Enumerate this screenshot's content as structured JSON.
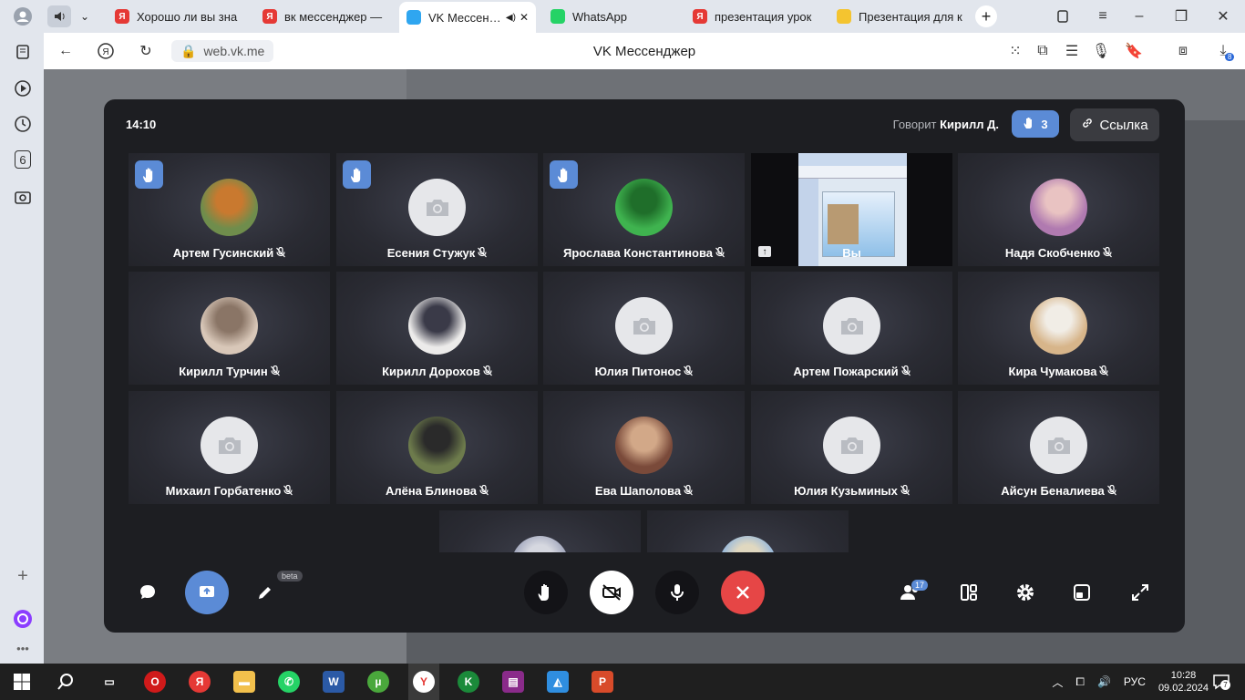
{
  "browser": {
    "tabs": [
      {
        "title": "Хорошо ли вы зна",
        "icon": "yandex-icon",
        "color": "#e53935"
      },
      {
        "title": "вк мессенджер —",
        "icon": "yandex-icon",
        "color": "#e53935"
      },
      {
        "title": "VK Мессендж",
        "icon": "vk-messenger-icon",
        "color": "#2fa6f0",
        "active": true
      },
      {
        "title": "WhatsApp",
        "icon": "whatsapp-icon",
        "color": "#25d366"
      },
      {
        "title": "презентация урок",
        "icon": "yandex-icon",
        "color": "#e53935"
      },
      {
        "title": "Презентация для к",
        "icon": "pen-icon",
        "color": "#f4c430"
      }
    ],
    "url": "web.vk.me",
    "page_title": "VK Мессенджер",
    "downloads_badge": "8",
    "sidebar_badge": "6"
  },
  "call": {
    "time": "14:10",
    "speaker_prefix": "Говорит",
    "speaker_name": "Кирилл Д.",
    "raised_hands": "3",
    "link_label": "Ссылка",
    "participants_count": "17",
    "beta_label": "beta",
    "participants": [
      {
        "name": "Артем Гусинский",
        "hand": true,
        "avatar": "photo",
        "c1": "#6f8d4c",
        "c2": "#c9792f"
      },
      {
        "name": "Есения Стужук",
        "hand": true,
        "avatar": "camera"
      },
      {
        "name": "Ярослава Константинова",
        "hand": true,
        "avatar": "photo",
        "c1": "#3fb34f",
        "c2": "#1f6e2a"
      },
      {
        "name": "Вы",
        "hand": false,
        "avatar": "screen"
      },
      {
        "name": "Надя Скобченко",
        "hand": false,
        "avatar": "photo",
        "c1": "#b07ab0",
        "c2": "#e9c3c2"
      },
      {
        "name": "Кирилл Турчин",
        "hand": false,
        "avatar": "photo",
        "c1": "#d8c7b8",
        "c2": "#8a7566"
      },
      {
        "name": "Кирилл Дорохов",
        "hand": false,
        "avatar": "photo",
        "c1": "#ecebea",
        "c2": "#3a3a48"
      },
      {
        "name": "Юлия Питонос",
        "hand": false,
        "avatar": "camera"
      },
      {
        "name": "Артем Пожарский",
        "hand": false,
        "avatar": "camera"
      },
      {
        "name": "Кира Чумакова",
        "hand": false,
        "avatar": "photo",
        "c1": "#d7b58a",
        "c2": "#f1ede6"
      },
      {
        "name": "Михаил Горбатенко",
        "hand": false,
        "avatar": "camera"
      },
      {
        "name": "Алёна Блинова",
        "hand": false,
        "avatar": "photo",
        "c1": "#6d7b4c",
        "c2": "#2a2a2a"
      },
      {
        "name": "Ева Шаполова",
        "hand": false,
        "avatar": "photo",
        "c1": "#7a4a3a",
        "c2": "#d2a888"
      },
      {
        "name": "Юлия Кузьминых",
        "hand": false,
        "avatar": "camera"
      },
      {
        "name": "Айсун Беналиева",
        "hand": false,
        "avatar": "camera"
      },
      {
        "name": "",
        "hand": false,
        "avatar": "photo",
        "c1": "#9aa0b8",
        "c2": "#d6d8e0"
      },
      {
        "name": "",
        "hand": false,
        "avatar": "photo",
        "c1": "#8cb4e0",
        "c2": "#e0d8c0"
      }
    ]
  },
  "taskbar": {
    "lang": "РУС",
    "time": "10:28",
    "date": "09.02.2024",
    "notifications": "7"
  }
}
